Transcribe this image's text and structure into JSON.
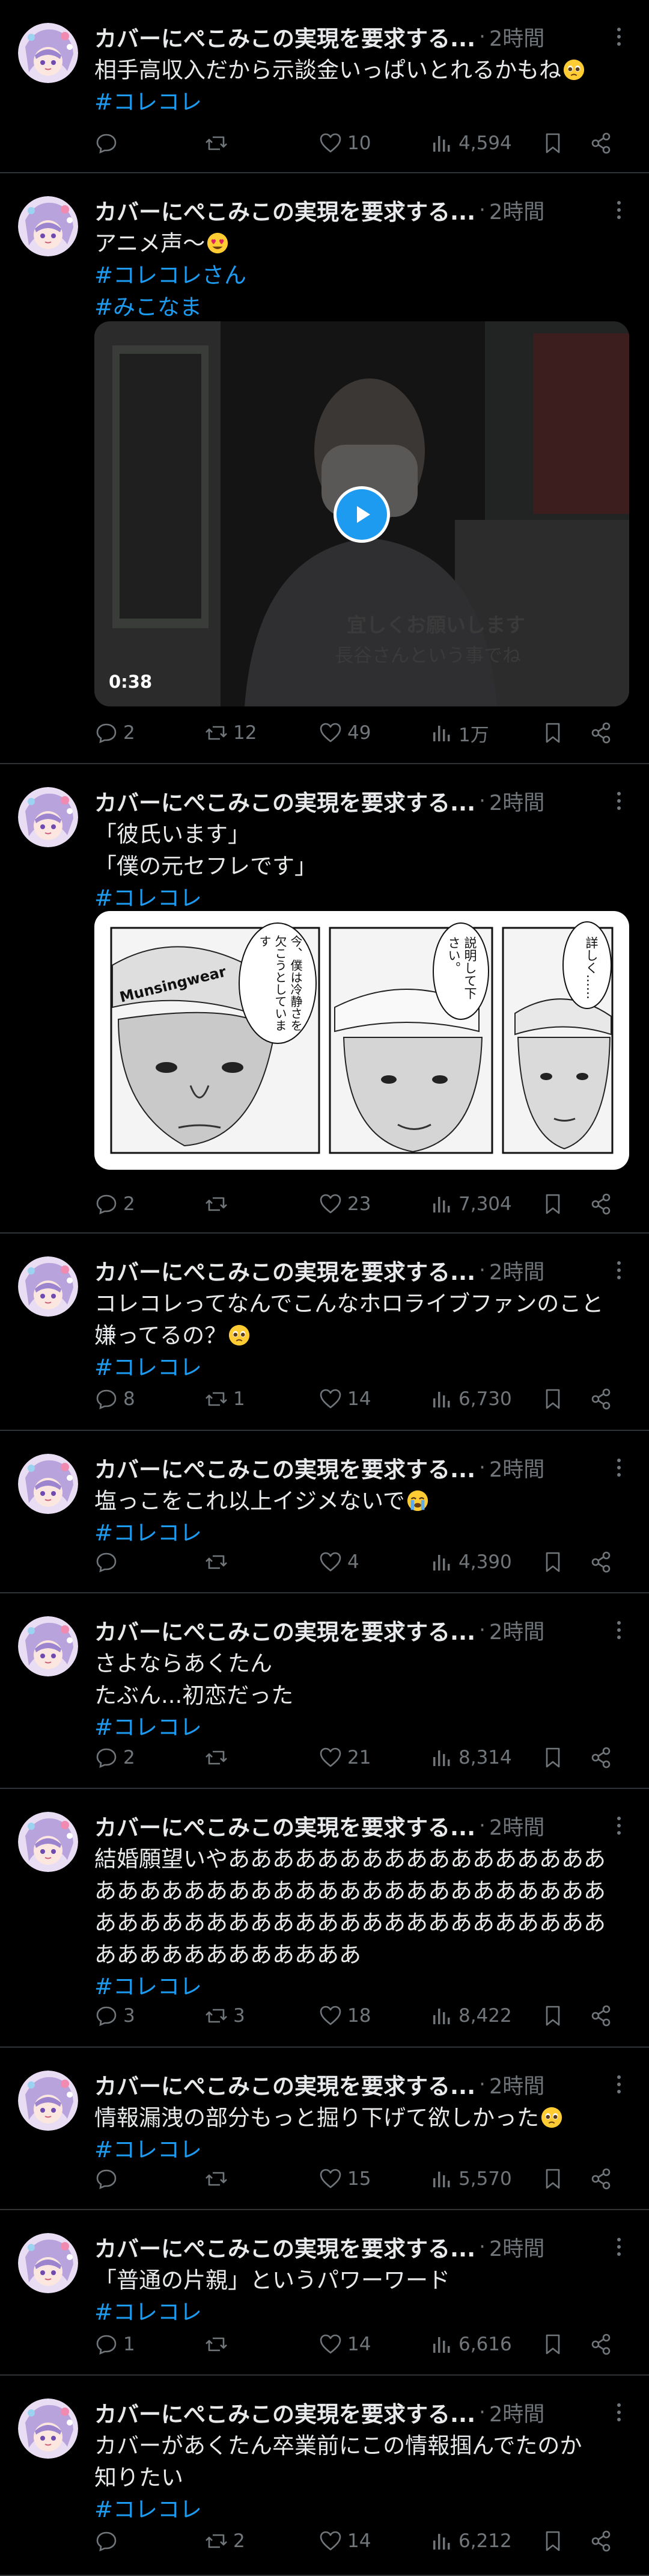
{
  "colors": {
    "background": "#000000",
    "text": "#e7e9ea",
    "muted": "#71767b",
    "hashtag": "#1d9bf0",
    "divider": "#2f3336"
  },
  "tweets": [
    {
      "author": "カバーにぺこみこの実現を要求する...",
      "time": "2時間",
      "lines": [
        "相手高収入だから示談金いっぱいとれるかもね"
      ],
      "hashtags": [
        "#コレコレ"
      ],
      "emoji_icon": "pleading-face-emoji",
      "reply_count": "",
      "retweet_count": "",
      "like_count": "10",
      "view_count": "4,594"
    },
    {
      "author": "カバーにぺこみこの実現を要求する...",
      "time": "2時間",
      "lines": [
        "アニメ声〜"
      ],
      "hashtags": [
        "#コレコレさん",
        "#みこなま"
      ],
      "emoji_icon": "heart-eyes-emoji",
      "video": {
        "duration": "0:38",
        "subtitle_1": "宜しくお願いします",
        "subtitle_2": "長谷さんという事でね"
      },
      "reply_count": "2",
      "retweet_count": "12",
      "like_count": "49",
      "view_count": "1万"
    },
    {
      "author": "カバーにぺこみこの実現を要求する...",
      "time": "2時間",
      "lines": [
        "「彼氏います」",
        "「僕の元セフレです」"
      ],
      "hashtags": [
        "#コレコレ"
      ],
      "manga": {
        "bubble_1": "今、僕は冷静さを欠こうとしています",
        "bubble_2": "説明して下さい。",
        "bubble_3": "詳しく……",
        "cap_text": "Munsingwear"
      },
      "reply_count": "2",
      "retweet_count": "",
      "like_count": "23",
      "view_count": "7,304"
    },
    {
      "author": "カバーにぺこみこの実現を要求する...",
      "time": "2時間",
      "lines": [
        "コレコレってなんでこんなホロライブファンのこと嫌ってるの？"
      ],
      "hashtags": [
        "#コレコレ"
      ],
      "emoji_icon": "pleading-face-emoji",
      "reply_count": "8",
      "retweet_count": "1",
      "like_count": "14",
      "view_count": "6,730"
    },
    {
      "author": "カバーにぺこみこの実現を要求する...",
      "time": "2時間",
      "lines": [
        "塩っこをこれ以上イジメないで"
      ],
      "hashtags": [
        "#コレコレ"
      ],
      "emoji_icon": "crying-face-emoji",
      "reply_count": "",
      "retweet_count": "",
      "like_count": "4",
      "view_count": "4,390"
    },
    {
      "author": "カバーにぺこみこの実現を要求する...",
      "time": "2時間",
      "lines": [
        "さよならあくたん",
        "たぶん...初恋だった"
      ],
      "hashtags": [
        "#コレコレ"
      ],
      "reply_count": "2",
      "retweet_count": "",
      "like_count": "21",
      "view_count": "8,314"
    },
    {
      "author": "カバーにぺこみこの実現を要求する...",
      "time": "2時間",
      "lines": [
        "結婚願望いやあああああああああああああああああああああああああああああああああああああああああああああああああああああああああああああああああああああああああああ"
      ],
      "hashtags": [
        "#コレコレ"
      ],
      "reply_count": "3",
      "retweet_count": "3",
      "like_count": "18",
      "view_count": "8,422"
    },
    {
      "author": "カバーにぺこみこの実現を要求する...",
      "time": "2時間",
      "lines": [
        "情報漏洩の部分もっと掘り下げて欲しかった"
      ],
      "hashtags": [
        "#コレコレ"
      ],
      "emoji_icon": "pleading-face-emoji",
      "reply_count": "",
      "retweet_count": "",
      "like_count": "15",
      "view_count": "5,570"
    },
    {
      "author": "カバーにぺこみこの実現を要求する...",
      "time": "2時間",
      "lines": [
        "「普通の片親」というパワーワード"
      ],
      "hashtags": [
        "#コレコレ"
      ],
      "reply_count": "1",
      "retweet_count": "",
      "like_count": "14",
      "view_count": "6,616"
    },
    {
      "author": "カバーにぺこみこの実現を要求する...",
      "time": "2時間",
      "lines": [
        "カバーがあくたん卒業前にこの情報掴んでたのか",
        "知りたい"
      ],
      "hashtags": [
        "#コレコレ"
      ],
      "reply_count": "",
      "retweet_count": "2",
      "like_count": "14",
      "view_count": "6,212"
    }
  ]
}
